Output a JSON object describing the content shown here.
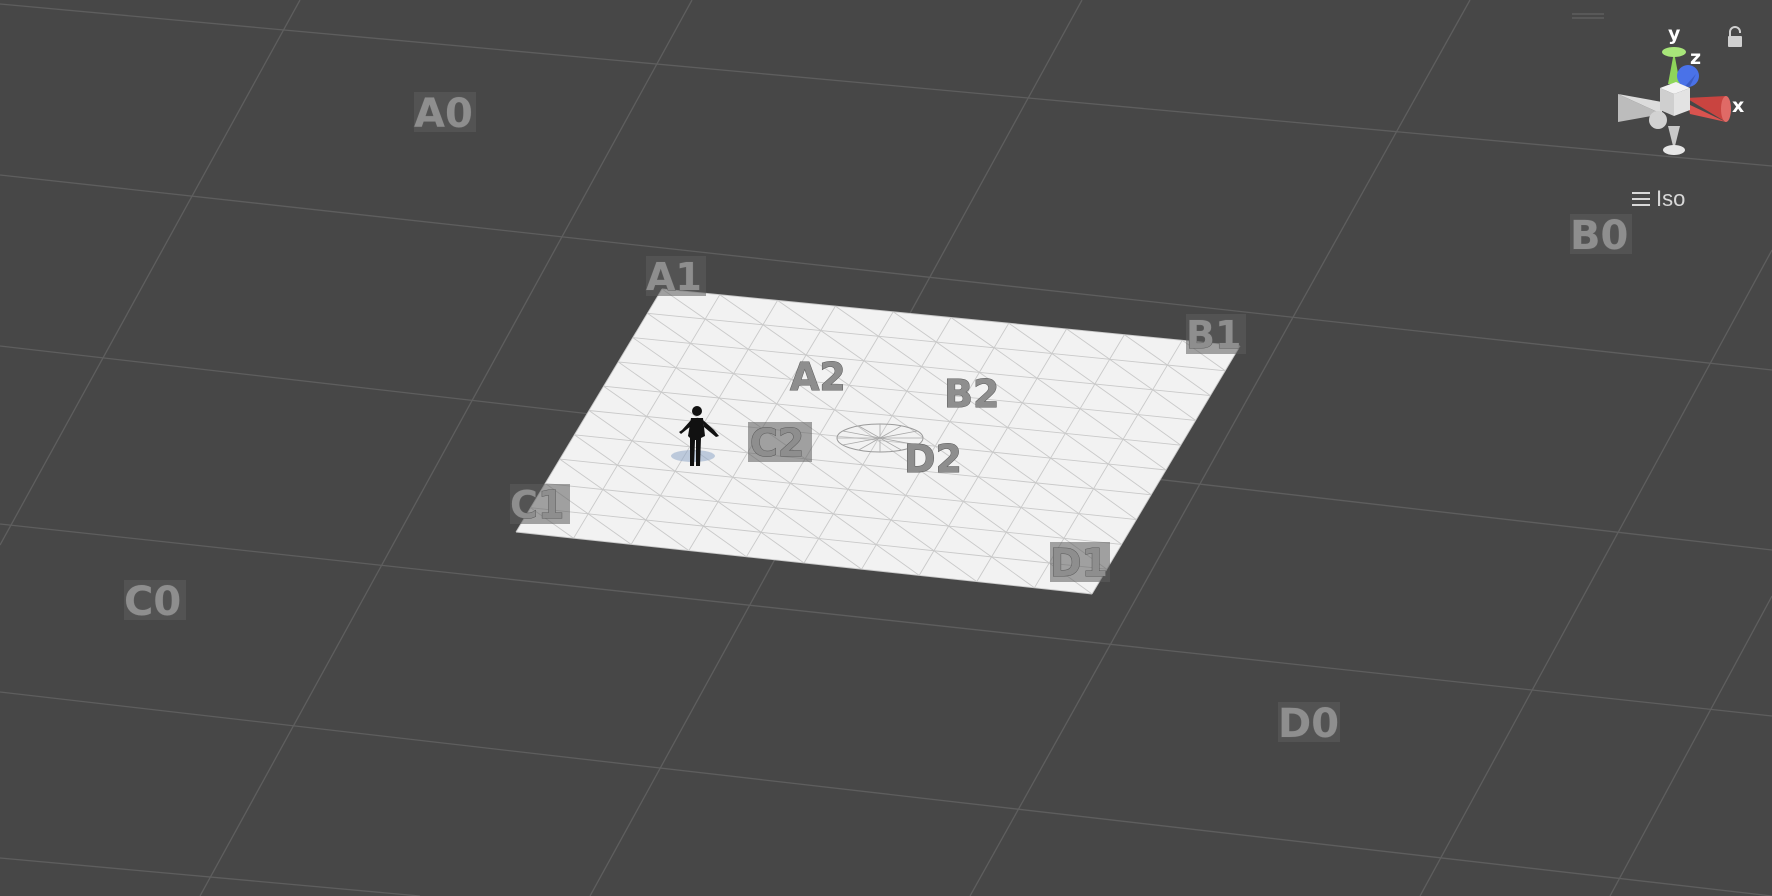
{
  "scene": {
    "projection_label": "Iso",
    "markers": [
      {
        "id": "A0",
        "label": "A0"
      },
      {
        "id": "B0",
        "label": "B0"
      },
      {
        "id": "C0",
        "label": "C0"
      },
      {
        "id": "D0",
        "label": "D0"
      },
      {
        "id": "A1",
        "label": "A1"
      },
      {
        "id": "B1",
        "label": "B1"
      },
      {
        "id": "C1",
        "label": "C1"
      },
      {
        "id": "D1",
        "label": "D1"
      },
      {
        "id": "A2",
        "label": "A2"
      },
      {
        "id": "B2",
        "label": "B2"
      },
      {
        "id": "C2",
        "label": "C2"
      },
      {
        "id": "D2",
        "label": "D2"
      }
    ]
  },
  "gizmo": {
    "axes": {
      "x": "x",
      "y": "y",
      "z": "z"
    },
    "colors": {
      "x": "#d9534f",
      "y": "#8ed65a",
      "z": "#4a72e8",
      "center": "#d8d8d8"
    }
  },
  "icons": {
    "lock": "lock-icon",
    "projection_menu": "hamburger-menu-icon",
    "character": "character-figure-icon"
  }
}
